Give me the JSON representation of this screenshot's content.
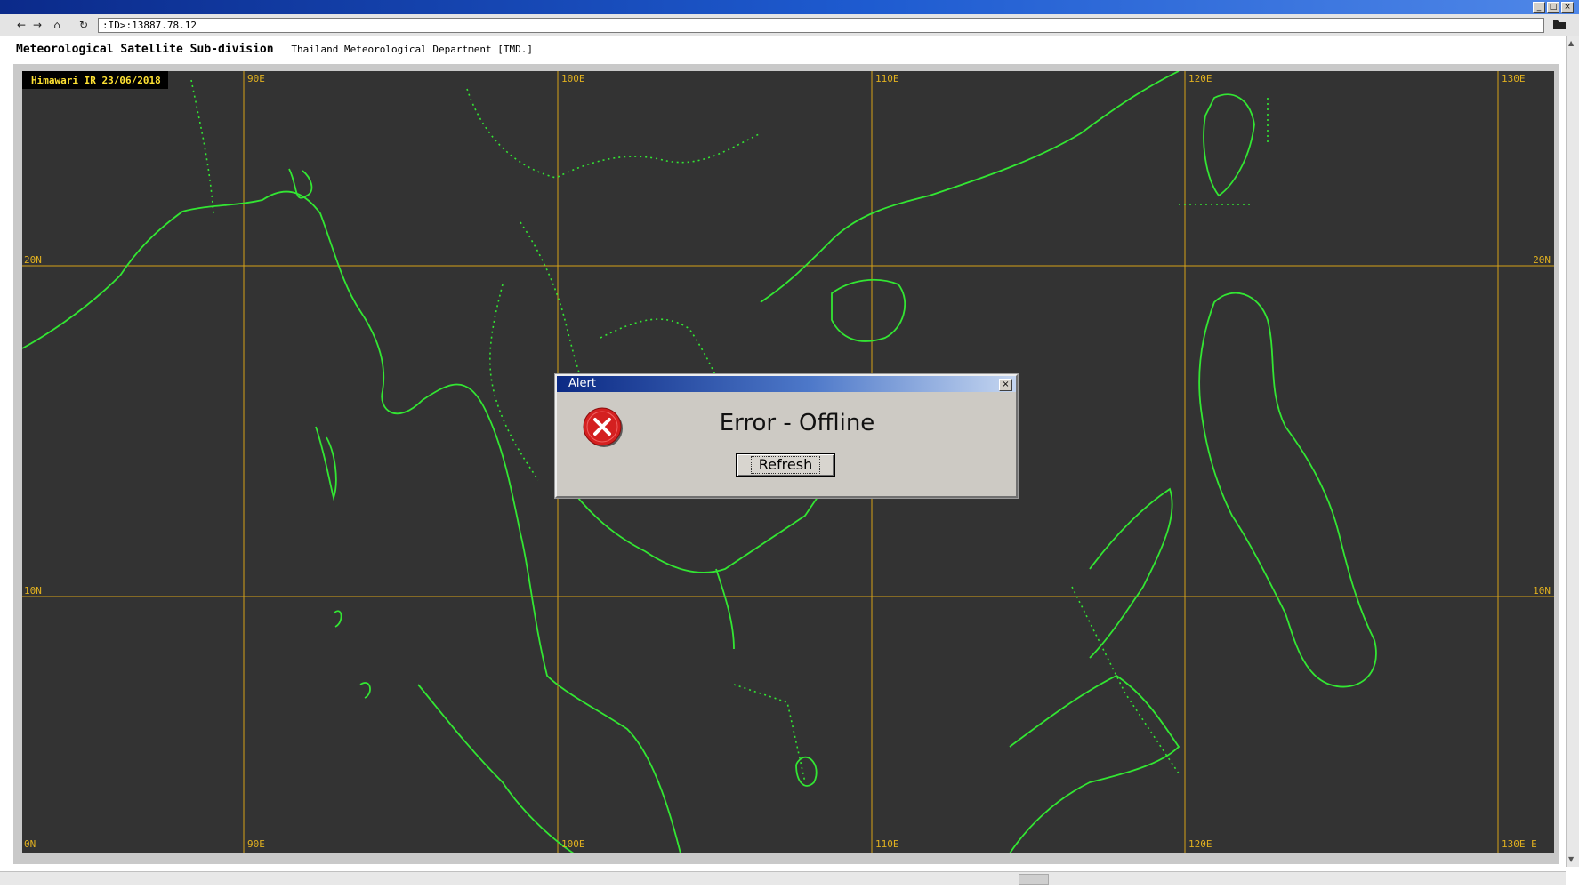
{
  "window": {
    "controls": [
      "minimize",
      "maximize",
      "close"
    ]
  },
  "toolbar": {
    "address": ":ID>:13887.78.12",
    "icons": [
      "back-arrow-icon",
      "forward-arrow-icon",
      "home-icon",
      "refresh-icon",
      "folder-icon"
    ]
  },
  "header": {
    "title": "Meteorological Satellite Sub-division",
    "subtitle": "Thailand Meteorological Department [TMD.]"
  },
  "map": {
    "badge": "Himawari IR 23/06/2018",
    "longitude_labels_top": [
      "90E",
      "100E",
      "110E",
      "120E",
      "130E"
    ],
    "longitude_labels_bottom": [
      "90E",
      "100E",
      "110E",
      "120E",
      "130E E"
    ],
    "latitude_labels_left": [
      "20N",
      "10N",
      "0N"
    ],
    "latitude_labels_right": [
      "20N",
      "10N"
    ],
    "colors": {
      "background": "#333333",
      "grid": "#d4a017",
      "coastline": "#33e633"
    }
  },
  "dialog": {
    "title": "Alert",
    "message": "Error - Offline",
    "button": "Refresh",
    "icon": "error-x-icon"
  }
}
